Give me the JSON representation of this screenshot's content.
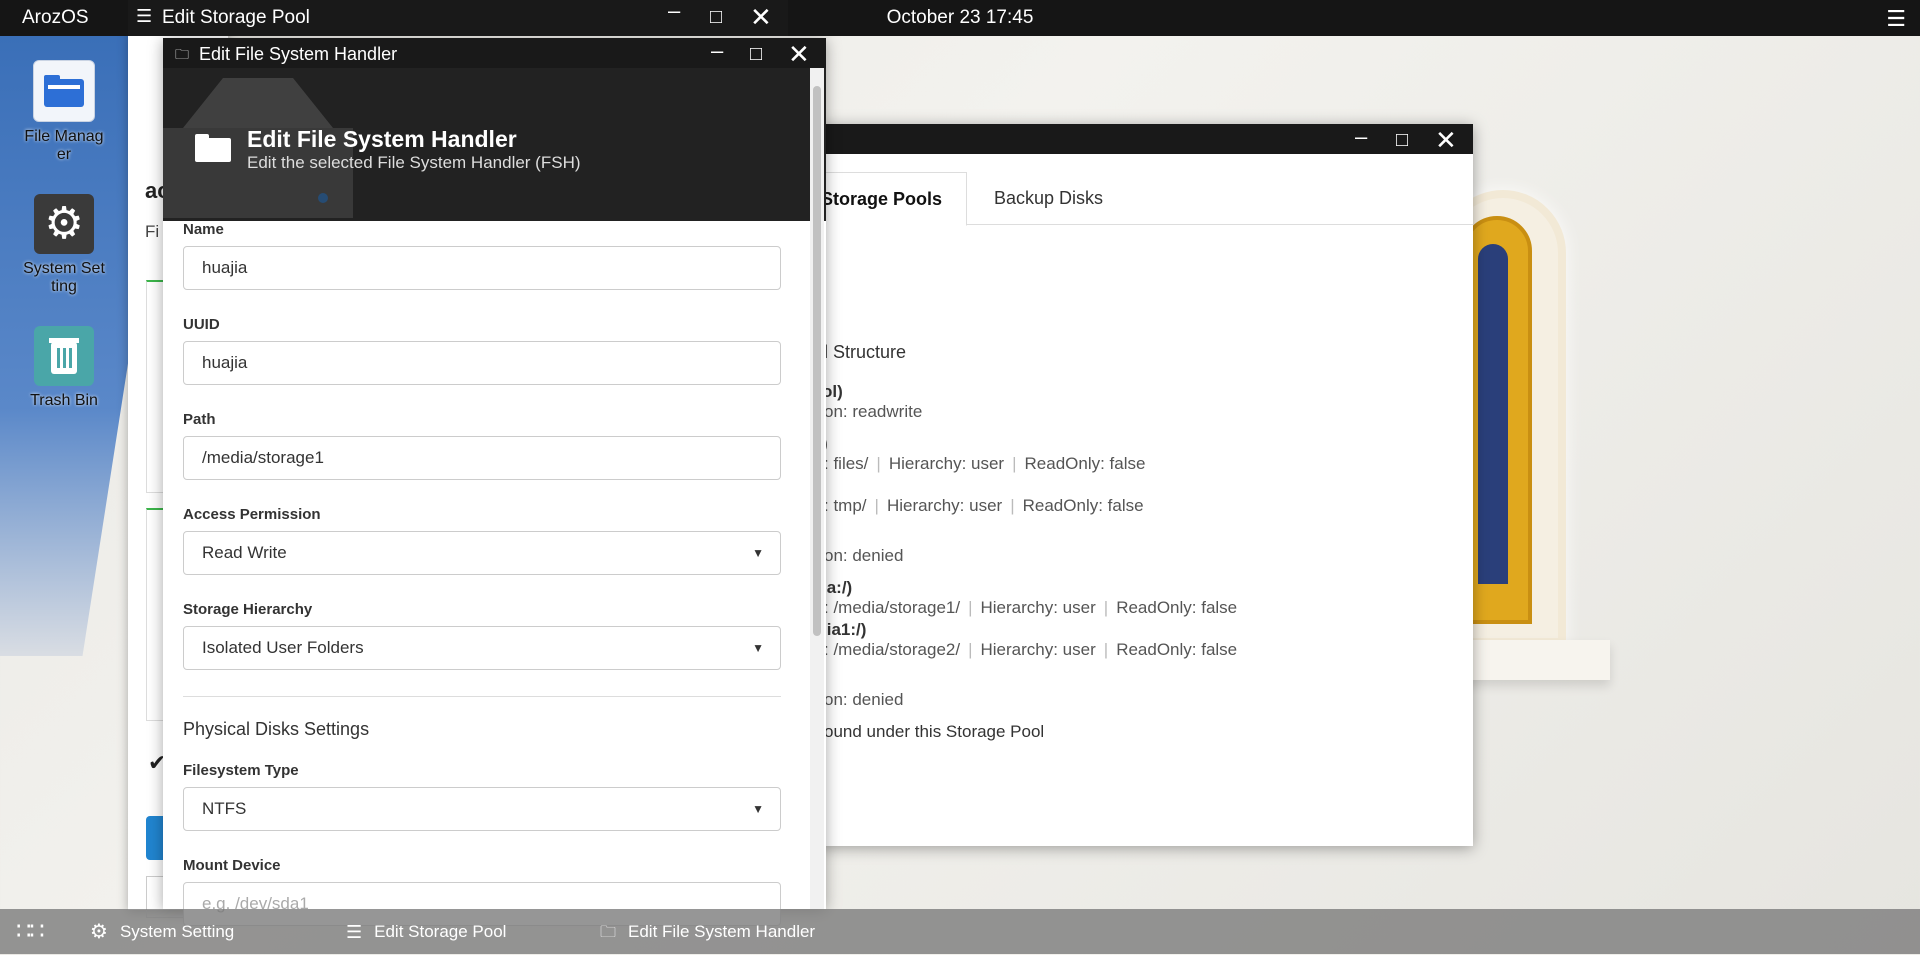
{
  "topbar": {
    "brand": "ArozOS",
    "clock": "October 23 17:45",
    "menu_icon": "hamburger-icon"
  },
  "desktop_icons": [
    {
      "label": "File Manag\ner",
      "icon": "file-manager-icon"
    },
    {
      "label": "System Set\nting",
      "icon": "gear-icon"
    },
    {
      "label": "Trash Bin",
      "icon": "trash-icon"
    }
  ],
  "storage_pool_window": {
    "title": "Edit Storage Pool",
    "tabs": [
      "Storage Pools",
      "Backup Disks"
    ],
    "left_fragments": {
      "heading": "ac",
      "sub": "Fi"
    },
    "lines": [
      {
        "text": "l Structure",
        "type": "section"
      },
      {
        "text": "ol)",
        "type": "bold"
      },
      {
        "text": "on: readwrite",
        "type": "grey"
      },
      {
        "text": ")",
        "type": "bold"
      },
      {
        "text": ": files/",
        "h": "Hierarchy: user",
        "r": "ReadOnly: false"
      },
      {
        "text": ": tmp/",
        "h": "Hierarchy: user",
        "r": "ReadOnly: false"
      },
      {
        "text": "on: denied",
        "type": "grey"
      },
      {
        "text": "ia:/)",
        "type": "bold"
      },
      {
        "text": ": /media/storage1/",
        "h": "Hierarchy: user",
        "r": "ReadOnly: false"
      },
      {
        "text": "jia1:/)",
        "type": "bold"
      },
      {
        "text": ": /media/storage2/",
        "h": "Hierarchy: user",
        "r": "ReadOnly: false"
      },
      {
        "text": "on: denied",
        "type": "grey"
      },
      {
        "text": "ound under this Storage Pool",
        "type": "plain"
      }
    ]
  },
  "fsh_window": {
    "title": "Edit File System Handler",
    "heading": "Edit File System Handler",
    "subheading": "Edit the selected File System Handler (FSH)",
    "fields": {
      "name": {
        "label": "Name",
        "value": "huajia"
      },
      "uuid": {
        "label": "UUID",
        "value": "huajia"
      },
      "path": {
        "label": "Path",
        "value": "/media/storage1"
      },
      "access": {
        "label": "Access Permission",
        "value": "Read Write"
      },
      "hierarchy": {
        "label": "Storage Hierarchy",
        "value": "Isolated User Folders"
      },
      "section": "Physical Disks Settings",
      "fstype": {
        "label": "Filesystem Type",
        "value": "NTFS"
      },
      "mount": {
        "label": "Mount Device",
        "placeholder": "e.g. /dev/sda1"
      }
    }
  },
  "taskbar": {
    "launcher_icon": "grid-icon",
    "items": [
      {
        "label": "System Setting",
        "icon": "gear-icon"
      },
      {
        "label": "Edit Storage Pool",
        "icon": "list-icon"
      },
      {
        "label": "Edit File System Handler",
        "icon": "folder-icon"
      }
    ]
  }
}
